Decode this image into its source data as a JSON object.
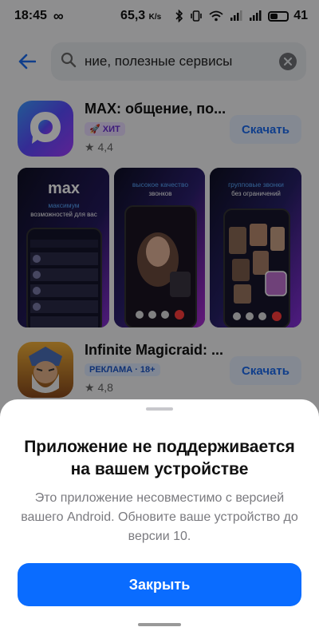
{
  "status_bar": {
    "time": "18:45",
    "speed": "65,3",
    "speed_unit": "K/s",
    "battery": "41"
  },
  "search": {
    "query": "ние, полезные сервисы"
  },
  "apps": [
    {
      "title": "MAX: общение, по...",
      "badge": "ХИТ",
      "rating": "4,4",
      "button": "Скачать",
      "screenshots": [
        {
          "logo": "max",
          "heading": "максимум",
          "subheading": "возможностей для вас"
        },
        {
          "heading": "высокое качество",
          "subheading": "звонков"
        },
        {
          "heading": "групповые звонки",
          "subheading": "без ограничений"
        }
      ]
    },
    {
      "title": "Infinite Magicraid: ...",
      "badge": "РЕКЛАМА · 18+",
      "rating": "4,8",
      "button": "Скачать"
    }
  ],
  "sheet": {
    "title": "Приложение не поддерживается на вашем устройстве",
    "message": "Это приложение несовместимо с версией вашего Android. Обновите ваше устройство до версии 10.",
    "close_label": "Закрыть"
  },
  "colors": {
    "accent": "#0a6cff",
    "max_brand": "#7a3cff"
  }
}
